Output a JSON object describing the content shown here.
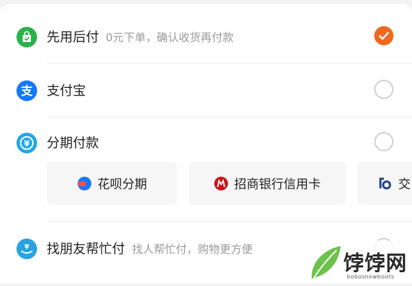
{
  "payment_options": [
    {
      "label": "先用后付",
      "subtitle": "0元下单，确认收货再付款",
      "icon": "bag-check-icon",
      "color": "#2bb24c",
      "checked": true
    },
    {
      "label": "支付宝",
      "subtitle": "",
      "icon": "alipay-icon",
      "color": "#1677ff",
      "checked": false
    },
    {
      "label": "分期付款",
      "subtitle": "",
      "icon": "installment-icon",
      "color": "#22a7e6",
      "checked": false
    },
    {
      "label": "找朋友帮忙付",
      "subtitle": "找人帮忙付，购物更方便",
      "icon": "friend-pay-icon",
      "color": "#29a3e0",
      "checked": false
    }
  ],
  "installment_chips": [
    {
      "label": "花呗分期",
      "icon": "huabei-icon"
    },
    {
      "label": "招商银行信用卡",
      "icon": "cmb-bank-icon"
    },
    {
      "label": "交",
      "icon": "bocom-bank-icon"
    }
  ],
  "colors": {
    "accent": "#f2681e",
    "radio_border": "#cfcfcf",
    "subtitle": "#9a9a9a"
  },
  "watermark": {
    "text": "饽饽网",
    "subtext": "bobosnowboots"
  }
}
